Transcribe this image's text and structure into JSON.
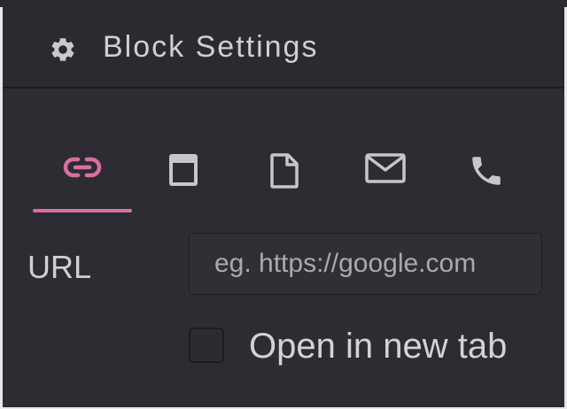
{
  "header": {
    "title": "Block Settings",
    "icon": "gear-icon"
  },
  "tabs": [
    {
      "name": "link",
      "icon": "link-icon",
      "active": true
    },
    {
      "name": "page",
      "icon": "window-icon",
      "active": false
    },
    {
      "name": "file",
      "icon": "file-icon",
      "active": false
    },
    {
      "name": "email",
      "icon": "mail-icon",
      "active": false
    },
    {
      "name": "phone",
      "icon": "phone-icon",
      "active": false
    }
  ],
  "url": {
    "label": "URL",
    "placeholder": "eg. https://google.com",
    "value": ""
  },
  "new_tab": {
    "label": "Open in new tab",
    "checked": false
  },
  "colors": {
    "background": "#2c2c32",
    "header_background": "#2a2a30",
    "accent": "#d8709f",
    "icon_inactive": "#c6c6cb",
    "text": "#cfcfd4"
  }
}
